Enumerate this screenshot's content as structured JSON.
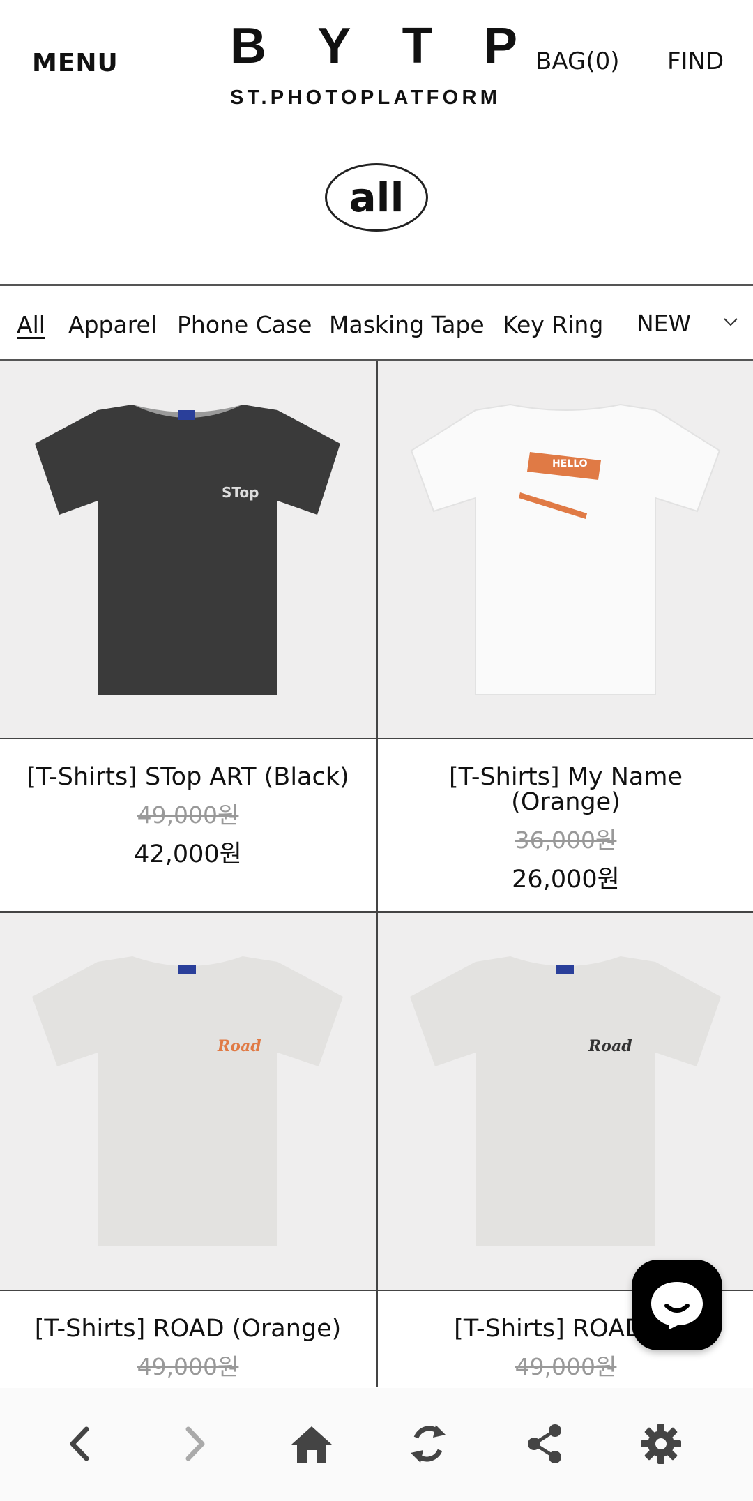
{
  "header": {
    "menu_label": "MENU",
    "logo_letters": [
      "B",
      "Y",
      "T",
      "P"
    ],
    "logo_sub": "ST.PHOTOPLATFORM",
    "bag_label": "BAG(0)",
    "find_label": "FIND"
  },
  "category_pill": "all",
  "tabs": [
    "All",
    "Apparel",
    "Phone Case",
    "Masking Tape",
    "Key Ring"
  ],
  "tab_new": "NEW",
  "products": [
    {
      "name": "[T-Shirts] STop ART (Black)",
      "original_price": "49,000원",
      "sale_price": "42,000원",
      "shirt_color": "#3a3a3a",
      "print_text": "STop"
    },
    {
      "name": "[T-Shirts] My Name (Orange)",
      "original_price": "36,000원",
      "sale_price": "26,000원",
      "shirt_color": "#fafafa",
      "print_text": "HELLO"
    },
    {
      "name": "[T-Shirts] ROAD (Orange)",
      "original_price": "49,000원",
      "sale_price": "",
      "shirt_color": "#e3e2e0",
      "print_text": "Road"
    },
    {
      "name": "[T-Shirts] ROAD (B",
      "original_price": "49,000원",
      "sale_price": "",
      "shirt_color": "#e3e2e0",
      "print_text": "Road"
    }
  ],
  "colors": {
    "accent_orange": "#e07a45",
    "line": "#444444",
    "strike_price": "#999999",
    "nav_icon": "#444444",
    "nav_icon_disabled": "#aaaaaa"
  },
  "bottom_nav": {
    "icons": [
      "chevron-left-icon",
      "chevron-right-icon",
      "home-icon",
      "refresh-icon",
      "share-icon",
      "gear-icon"
    ]
  }
}
